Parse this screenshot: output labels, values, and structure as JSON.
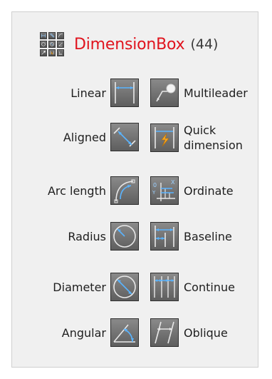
{
  "header": {
    "title": "DimensionBox",
    "count": "(44)",
    "icon": "dimension-grid-icon"
  },
  "tools": [
    {
      "label": "Linear",
      "icon": "linear-dimension-icon"
    },
    {
      "label": "Multileader",
      "icon": "multileader-icon"
    },
    {
      "label": "Aligned",
      "icon": "aligned-dimension-icon"
    },
    {
      "label_line1": "Quick",
      "label_line2": "dimension",
      "icon": "quick-dimension-icon"
    },
    {
      "label": "Arc length",
      "icon": "arc-length-icon"
    },
    {
      "label": "Ordinate",
      "icon": "ordinate-icon"
    },
    {
      "label": "Radius",
      "icon": "radius-icon"
    },
    {
      "label": "Baseline",
      "icon": "baseline-icon"
    },
    {
      "label": "Diameter",
      "icon": "diameter-icon"
    },
    {
      "label": "Continue",
      "icon": "continue-icon"
    },
    {
      "label": "Angular",
      "icon": "angular-icon"
    },
    {
      "label": "Oblique",
      "icon": "oblique-icon"
    }
  ],
  "colors": {
    "title": "#e0141e",
    "dimension_line": "#5ab4ff",
    "icon_background": "#6e6e6e",
    "accent_bolt": "#f5a623"
  }
}
